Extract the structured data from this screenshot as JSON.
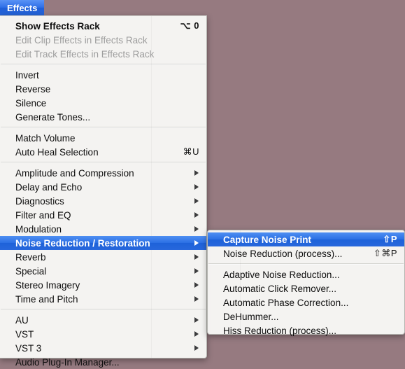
{
  "window": {
    "background_color": "#967a80",
    "menu_background_color": "#f8f8f6",
    "highlight_color": "#2b6fe4",
    "disabled_text_color": "#9d9d9d"
  },
  "menubar": {
    "active_title": "Effects"
  },
  "main_menu": {
    "groups": [
      {
        "items": [
          {
            "label": "Show Effects Rack",
            "shortcut": "⌥ 0",
            "enabled": true,
            "bold": true,
            "has_submenu": false
          },
          {
            "label": "Edit Clip Effects in Effects Rack",
            "shortcut": "",
            "enabled": false,
            "bold": false,
            "has_submenu": false
          },
          {
            "label": "Edit Track Effects in Effects Rack",
            "shortcut": "",
            "enabled": false,
            "bold": false,
            "has_submenu": false
          }
        ]
      },
      {
        "items": [
          {
            "label": "Invert",
            "shortcut": "",
            "enabled": true,
            "bold": false,
            "has_submenu": false
          },
          {
            "label": "Reverse",
            "shortcut": "",
            "enabled": true,
            "bold": false,
            "has_submenu": false
          },
          {
            "label": "Silence",
            "shortcut": "",
            "enabled": true,
            "bold": false,
            "has_submenu": false
          },
          {
            "label": "Generate Tones...",
            "shortcut": "",
            "enabled": true,
            "bold": false,
            "has_submenu": false
          }
        ]
      },
      {
        "items": [
          {
            "label": "Match Volume",
            "shortcut": "",
            "enabled": true,
            "bold": false,
            "has_submenu": false
          },
          {
            "label": "Auto Heal Selection",
            "shortcut": "⌘U",
            "enabled": true,
            "bold": false,
            "has_submenu": false
          }
        ]
      },
      {
        "items": [
          {
            "label": "Amplitude and Compression",
            "shortcut": "",
            "enabled": true,
            "bold": false,
            "has_submenu": true
          },
          {
            "label": "Delay and Echo",
            "shortcut": "",
            "enabled": true,
            "bold": false,
            "has_submenu": true
          },
          {
            "label": "Diagnostics",
            "shortcut": "",
            "enabled": true,
            "bold": false,
            "has_submenu": true
          },
          {
            "label": "Filter and EQ",
            "shortcut": "",
            "enabled": true,
            "bold": false,
            "has_submenu": true
          },
          {
            "label": "Modulation",
            "shortcut": "",
            "enabled": true,
            "bold": false,
            "has_submenu": true
          },
          {
            "label": "Noise Reduction / Restoration",
            "shortcut": "",
            "enabled": true,
            "bold": false,
            "has_submenu": true,
            "selected": true
          },
          {
            "label": "Reverb",
            "shortcut": "",
            "enabled": true,
            "bold": false,
            "has_submenu": true
          },
          {
            "label": "Special",
            "shortcut": "",
            "enabled": true,
            "bold": false,
            "has_submenu": true
          },
          {
            "label": "Stereo Imagery",
            "shortcut": "",
            "enabled": true,
            "bold": false,
            "has_submenu": true
          },
          {
            "label": "Time and Pitch",
            "shortcut": "",
            "enabled": true,
            "bold": false,
            "has_submenu": true
          }
        ]
      },
      {
        "items": [
          {
            "label": "AU",
            "shortcut": "",
            "enabled": true,
            "bold": false,
            "has_submenu": true
          },
          {
            "label": "VST",
            "shortcut": "",
            "enabled": true,
            "bold": false,
            "has_submenu": true
          },
          {
            "label": "VST 3",
            "shortcut": "",
            "enabled": true,
            "bold": false,
            "has_submenu": true
          },
          {
            "label": "Audio Plug-In Manager...",
            "shortcut": "",
            "enabled": true,
            "bold": false,
            "has_submenu": false
          }
        ]
      }
    ]
  },
  "sub_menu": {
    "parent": "Noise Reduction / Restoration",
    "groups": [
      {
        "items": [
          {
            "label": "Capture Noise Print",
            "shortcut": "⇧P",
            "enabled": true,
            "selected": true,
            "has_submenu": false
          },
          {
            "label": "Noise Reduction (process)...",
            "shortcut": "⇧⌘P",
            "enabled": true,
            "has_submenu": false
          }
        ]
      },
      {
        "items": [
          {
            "label": "Adaptive Noise Reduction...",
            "shortcut": "",
            "enabled": true,
            "has_submenu": false
          },
          {
            "label": "Automatic Click Remover...",
            "shortcut": "",
            "enabled": true,
            "has_submenu": false
          },
          {
            "label": "Automatic Phase Correction...",
            "shortcut": "",
            "enabled": true,
            "has_submenu": false
          },
          {
            "label": "DeHummer...",
            "shortcut": "",
            "enabled": true,
            "has_submenu": false
          },
          {
            "label": "Hiss Reduction (process)...",
            "shortcut": "",
            "enabled": true,
            "has_submenu": false
          }
        ]
      }
    ]
  }
}
